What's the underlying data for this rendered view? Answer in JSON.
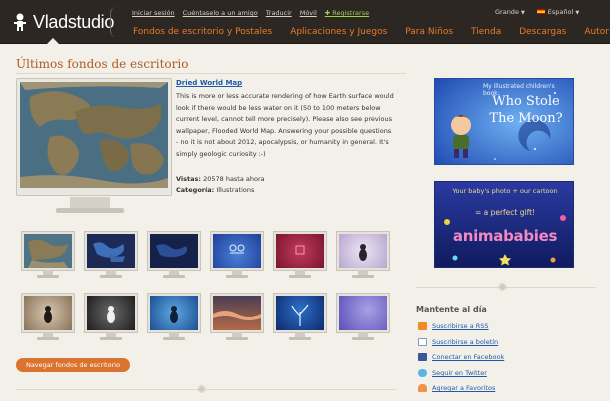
{
  "header": {
    "logo_text": "Vladstudio",
    "top_links": [
      "Iniciar sesión",
      "Cuéntaselo a un amigo",
      "Traducir",
      "Móvil",
      "Registrarse"
    ],
    "size_label": "Grande",
    "language_label": "Español",
    "nav": [
      "Fondos de escritorio y Postales",
      "Aplicaciones y Juegos",
      "Para Niños",
      "Tienda",
      "Descargas",
      "Autor"
    ]
  },
  "main": {
    "title": "Últimos fondos de escritorio",
    "featured": {
      "title": "Dried World Map",
      "description": "This is more or less accurate rendering of how Earth surface would look if there would be less water on it (50 to 100 meters below current level, cannot tell more precisely). Please also see previous wallpaper, Flooded World Map. Answering your possible questions - no it is not about 2012, apocalypsis, or humanity in general. It's simply geologic curiosity :-)",
      "views_label": "Vistas",
      "views_value": "20578 hasta ahora",
      "category_label": "Categoría",
      "category_value": "Illustrations"
    },
    "browse_button": "Navegar fondos de escritorio"
  },
  "sidebar": {
    "ad1": {
      "top_line": "My illustrated children's book:",
      "title_1": "Who Stole",
      "title_2": "The Moon?"
    },
    "ad2": {
      "line1": "Your baby's photo + our cartoon",
      "line2": "= a perfect gift!",
      "brand": "animababies"
    },
    "section_title": "Mantente al día",
    "links": [
      "Suscribirse a RSS",
      "Suscribirse a boletín",
      "Conectar en Facebook",
      "Seguir en Twitter",
      "Agregar a Favoritos"
    ]
  },
  "colors": {
    "accent": "#d9732e",
    "link": "#1e5aa8",
    "header_bg": "#2c2723",
    "page_bg": "#f3f0ea"
  }
}
